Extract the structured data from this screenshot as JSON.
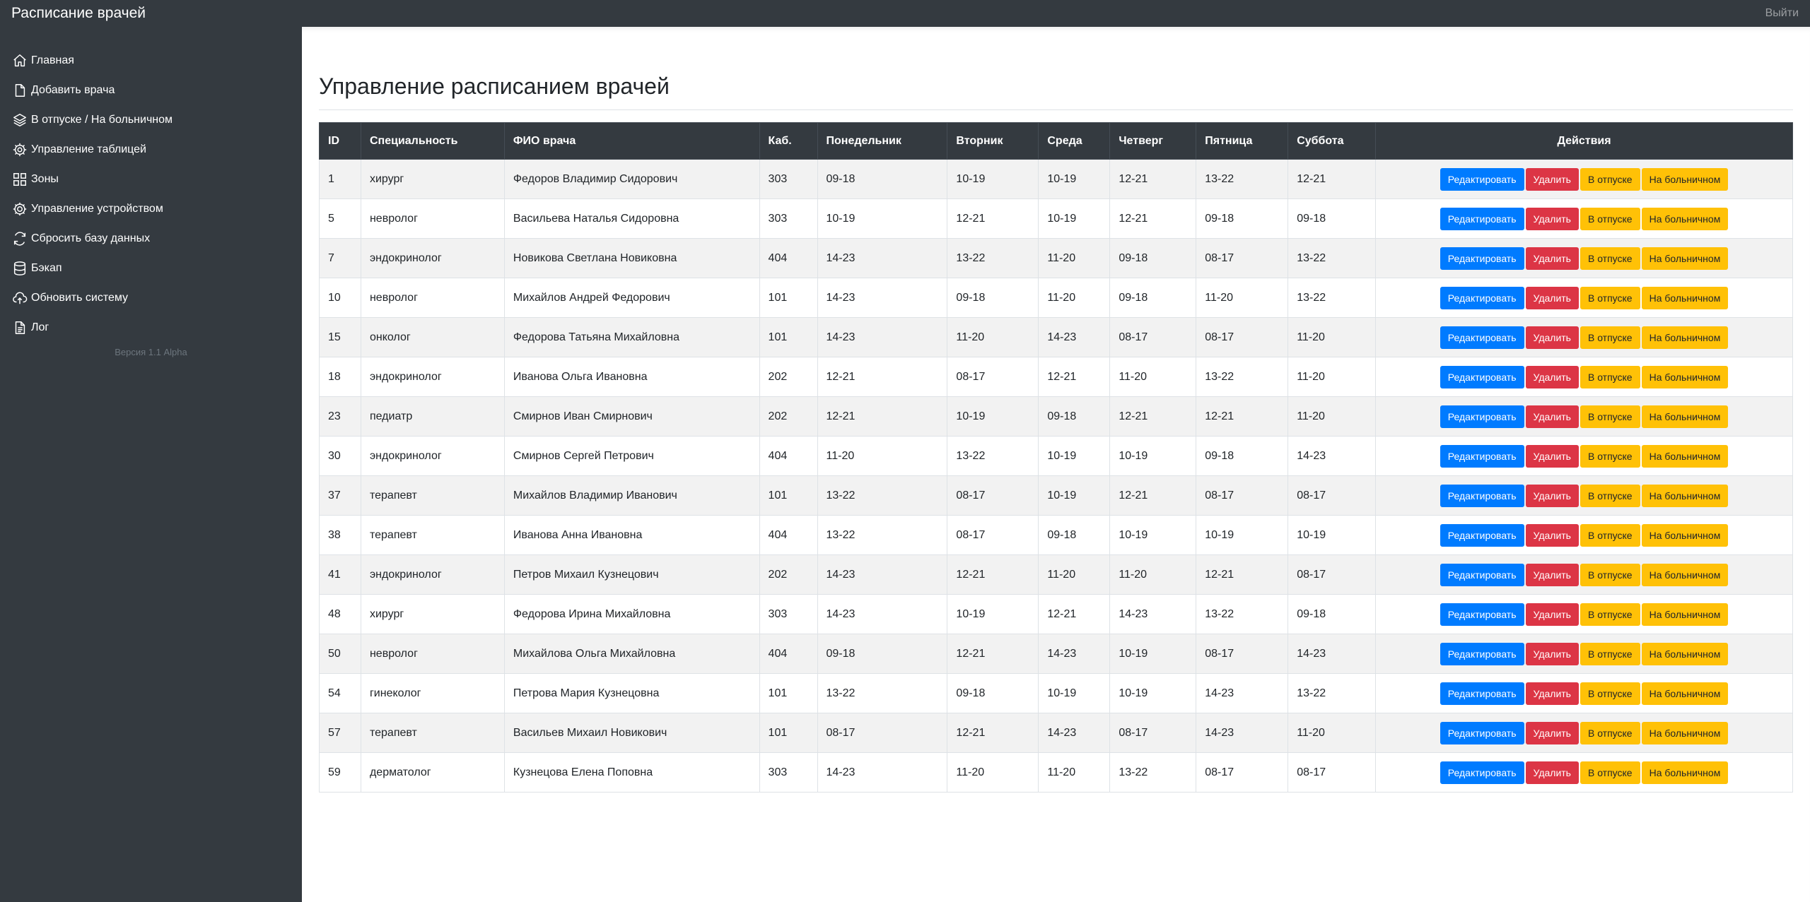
{
  "app": {
    "title": "Расписание врачей",
    "logout_label": "Выйти"
  },
  "sidebar": {
    "items": [
      {
        "label": "Главная",
        "icon": "home-icon"
      },
      {
        "label": "Добавить врача",
        "icon": "file-icon"
      },
      {
        "label": "В отпуске / На больничном",
        "icon": "layers-icon"
      },
      {
        "label": "Управление таблицей",
        "icon": "gear-icon"
      },
      {
        "label": "Зоны",
        "icon": "grid-icon"
      },
      {
        "label": "Управление устройством",
        "icon": "cpu-icon"
      },
      {
        "label": "Сбросить базу данных",
        "icon": "refresh-icon"
      },
      {
        "label": "Бэкап",
        "icon": "database-icon"
      },
      {
        "label": "Обновить систему",
        "icon": "cloud-upload-icon"
      },
      {
        "label": "Лог",
        "icon": "document-icon"
      }
    ],
    "version": "Версия 1.1 Alpha"
  },
  "main": {
    "title": "Управление расписанием врачей",
    "table": {
      "headers": [
        "ID",
        "Специальность",
        "ФИО врача",
        "Каб.",
        "Понедельник",
        "Вторник",
        "Среда",
        "Четверг",
        "Пятница",
        "Суббота",
        "Действия"
      ],
      "rows": [
        [
          "1",
          "хирург",
          "Федоров Владимир Сидорович",
          "303",
          "09-18",
          "10-19",
          "10-19",
          "12-21",
          "13-22",
          "12-21"
        ],
        [
          "5",
          "невролог",
          "Васильева Наталья Сидоровна",
          "303",
          "10-19",
          "12-21",
          "10-19",
          "12-21",
          "09-18",
          "09-18"
        ],
        [
          "7",
          "эндокринолог",
          "Новикова Светлана Новиковна",
          "404",
          "14-23",
          "13-22",
          "11-20",
          "09-18",
          "08-17",
          "13-22"
        ],
        [
          "10",
          "невролог",
          "Михайлов Андрей Федорович",
          "101",
          "14-23",
          "09-18",
          "11-20",
          "09-18",
          "11-20",
          "13-22"
        ],
        [
          "15",
          "онколог",
          "Федорова Татьяна Михайловна",
          "101",
          "14-23",
          "11-20",
          "14-23",
          "08-17",
          "08-17",
          "11-20"
        ],
        [
          "18",
          "эндокринолог",
          "Иванова Ольга Ивановна",
          "202",
          "12-21",
          "08-17",
          "12-21",
          "11-20",
          "13-22",
          "11-20"
        ],
        [
          "23",
          "педиатр",
          "Смирнов Иван Смирнович",
          "202",
          "12-21",
          "10-19",
          "09-18",
          "12-21",
          "12-21",
          "11-20"
        ],
        [
          "30",
          "эндокринолог",
          "Смирнов Сергей Петрович",
          "404",
          "11-20",
          "13-22",
          "10-19",
          "10-19",
          "09-18",
          "14-23"
        ],
        [
          "37",
          "терапевт",
          "Михайлов Владимир Иванович",
          "101",
          "13-22",
          "08-17",
          "10-19",
          "12-21",
          "08-17",
          "08-17"
        ],
        [
          "38",
          "терапевт",
          "Иванова Анна Ивановна",
          "404",
          "13-22",
          "08-17",
          "09-18",
          "10-19",
          "10-19",
          "10-19"
        ],
        [
          "41",
          "эндокринолог",
          "Петров Михаил Кузнецович",
          "202",
          "14-23",
          "12-21",
          "11-20",
          "11-20",
          "12-21",
          "08-17"
        ],
        [
          "48",
          "хирург",
          "Федорова Ирина Михайловна",
          "303",
          "14-23",
          "10-19",
          "12-21",
          "14-23",
          "13-22",
          "09-18"
        ],
        [
          "50",
          "невролог",
          "Михайлова Ольга Михайловна",
          "404",
          "09-18",
          "12-21",
          "14-23",
          "10-19",
          "08-17",
          "14-23"
        ],
        [
          "54",
          "гинеколог",
          "Петрова Мария Кузнецовна",
          "101",
          "13-22",
          "09-18",
          "10-19",
          "10-19",
          "14-23",
          "13-22"
        ],
        [
          "57",
          "терапевт",
          "Васильев Михаил Новикович",
          "101",
          "08-17",
          "12-21",
          "14-23",
          "08-17",
          "14-23",
          "11-20"
        ],
        [
          "59",
          "дерматолог",
          "Кузнецова Елена Поповна",
          "303",
          "14-23",
          "11-20",
          "11-20",
          "13-22",
          "08-17",
          "08-17"
        ]
      ],
      "actions": {
        "edit": "Редактировать",
        "delete": "Удалить",
        "vacation": "В отпуске",
        "sick": "На больничном"
      }
    }
  },
  "colors": {
    "dark": "#343a40",
    "primary": "#007bff",
    "danger": "#dc3545",
    "warning": "#ffc107",
    "stripe": "#f2f2f2"
  }
}
